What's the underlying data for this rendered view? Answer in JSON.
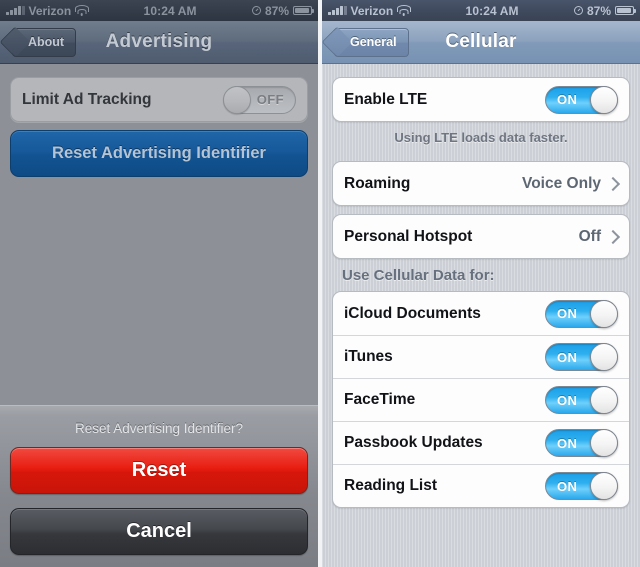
{
  "left_phone": {
    "status_bar": {
      "carrier": "Verizon",
      "time": "10:24 AM",
      "battery_percent": "87%",
      "signal_icon": "signal-bars-icon",
      "wifi_icon": "wifi-icon",
      "alarm_icon": "alarm-clock-icon",
      "battery_icon": "battery-icon"
    },
    "nav": {
      "back_label": "About",
      "title": "Advertising"
    },
    "rows": [
      {
        "label": "Limit Ad Tracking",
        "switch_state": "OFF"
      }
    ],
    "primary_button": "Reset Advertising Identifier",
    "action_sheet": {
      "title": "Reset Advertising Identifier?",
      "destructive_label": "Reset",
      "cancel_label": "Cancel"
    }
  },
  "right_phone": {
    "status_bar": {
      "carrier": "Verizon",
      "time": "10:24 AM",
      "battery_percent": "87%",
      "signal_icon": "signal-bars-icon",
      "wifi_icon": "wifi-icon",
      "alarm_icon": "alarm-clock-icon",
      "battery_icon": "battery-icon"
    },
    "nav": {
      "back_label": "General",
      "title": "Cellular"
    },
    "lte": {
      "label": "Enable LTE",
      "switch_state": "ON"
    },
    "lte_footnote": "Using LTE loads data faster.",
    "disclosure_rows": [
      {
        "label": "Roaming",
        "value": "Voice Only",
        "chevron_icon": "chevron-right-icon"
      },
      {
        "label": "Personal Hotspot",
        "value": "Off",
        "chevron_icon": "chevron-right-icon"
      }
    ],
    "cellular_data_header": "Use Cellular Data for:",
    "cellular_data_rows": [
      {
        "label": "iCloud Documents",
        "switch_state": "ON"
      },
      {
        "label": "iTunes",
        "switch_state": "ON"
      },
      {
        "label": "FaceTime",
        "switch_state": "ON"
      },
      {
        "label": "Passbook Updates",
        "switch_state": "ON"
      },
      {
        "label": "Reading List",
        "switch_state": "ON"
      }
    ]
  },
  "colors": {
    "accent_blue": "#2aa7ec",
    "destructive_red": "#e81d11",
    "button_blue": "#125391",
    "navbar_bright": "#819ab9",
    "navbar_dim": "#58657a"
  }
}
